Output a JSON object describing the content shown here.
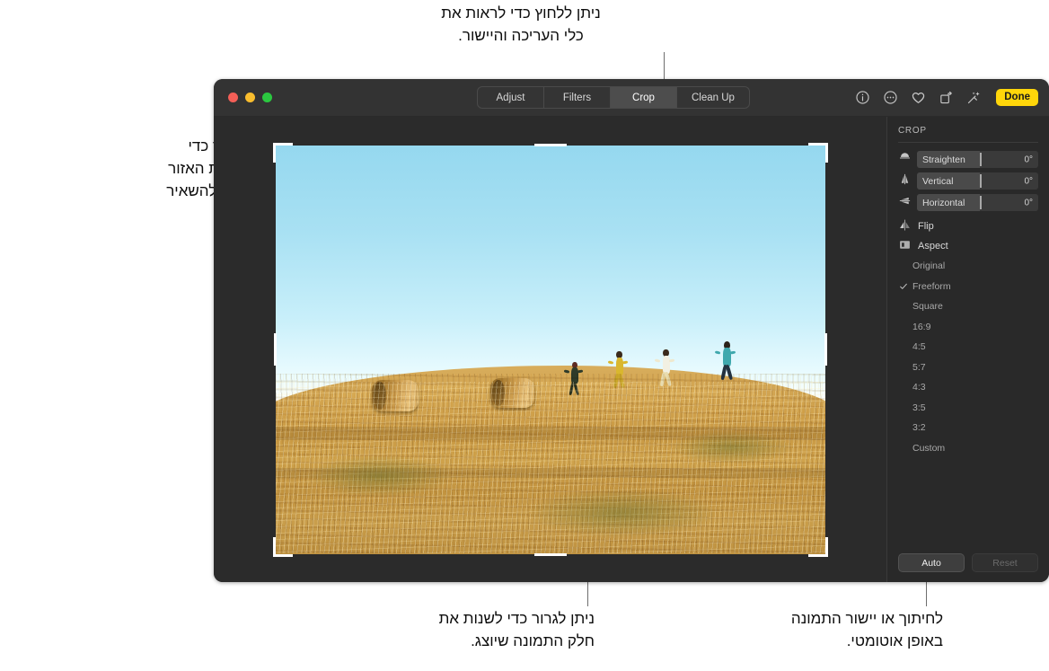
{
  "callouts": {
    "top": "ניתן ללחוץ כדי לראות את\nכלי העריכה והיישור.",
    "left": "ניתן לגרור כדי\nלתחום את האזור\nשברצונך להשאיר\nבתמונה.",
    "bottom": "ניתן לגרור כדי לשנות את\nחלק התמונה שיוצג.",
    "bottom_right": "לחיתוך או יישור התמונה\nבאופן אוטומטי."
  },
  "window": {
    "traffic_lights": [
      {
        "name": "close",
        "color": "#f45f57"
      },
      {
        "name": "minimize",
        "color": "#f9bd2e"
      },
      {
        "name": "zoom",
        "color": "#2bc840"
      }
    ],
    "segmented_control": [
      {
        "label": "Adjust",
        "active": false
      },
      {
        "label": "Filters",
        "active": false
      },
      {
        "label": "Crop",
        "active": true
      },
      {
        "label": "Clean Up",
        "active": false
      }
    ],
    "toolbar_icons": [
      "info-icon",
      "more-options-icon",
      "favorite-heart-icon",
      "rotate-icon",
      "auto-enhance-wand-icon"
    ],
    "done_label": "Done"
  },
  "inspector": {
    "title": "CROP",
    "sliders": [
      {
        "icon": "straighten-icon",
        "label": "Straighten",
        "value": "0°"
      },
      {
        "icon": "vertical-perspective-icon",
        "label": "Vertical",
        "value": "0°"
      },
      {
        "icon": "horizontal-perspective-icon",
        "label": "Horizontal",
        "value": "0°"
      }
    ],
    "flip": {
      "icon": "flip-icon",
      "label": "Flip"
    },
    "aspect": {
      "icon": "aspect-icon",
      "label": "Aspect"
    },
    "aspect_options": [
      {
        "label": "Original",
        "selected": false
      },
      {
        "label": "Freeform",
        "selected": true
      },
      {
        "label": "Square",
        "selected": false
      },
      {
        "label": "16:9",
        "selected": false
      },
      {
        "label": "4:5",
        "selected": false
      },
      {
        "label": "5:7",
        "selected": false
      },
      {
        "label": "4:3",
        "selected": false
      },
      {
        "label": "3:5",
        "selected": false
      },
      {
        "label": "3:2",
        "selected": false
      },
      {
        "label": "Custom",
        "selected": false
      }
    ],
    "auto_label": "Auto",
    "reset_label": "Reset"
  },
  "colors": {
    "accent_done": "#ffd60a",
    "window_bg": "#2b2b2b",
    "titlebar_bg": "#333333",
    "inspector_bg": "#292929",
    "sky_top": "#95d8ef",
    "field_gold": "#c99a45"
  }
}
